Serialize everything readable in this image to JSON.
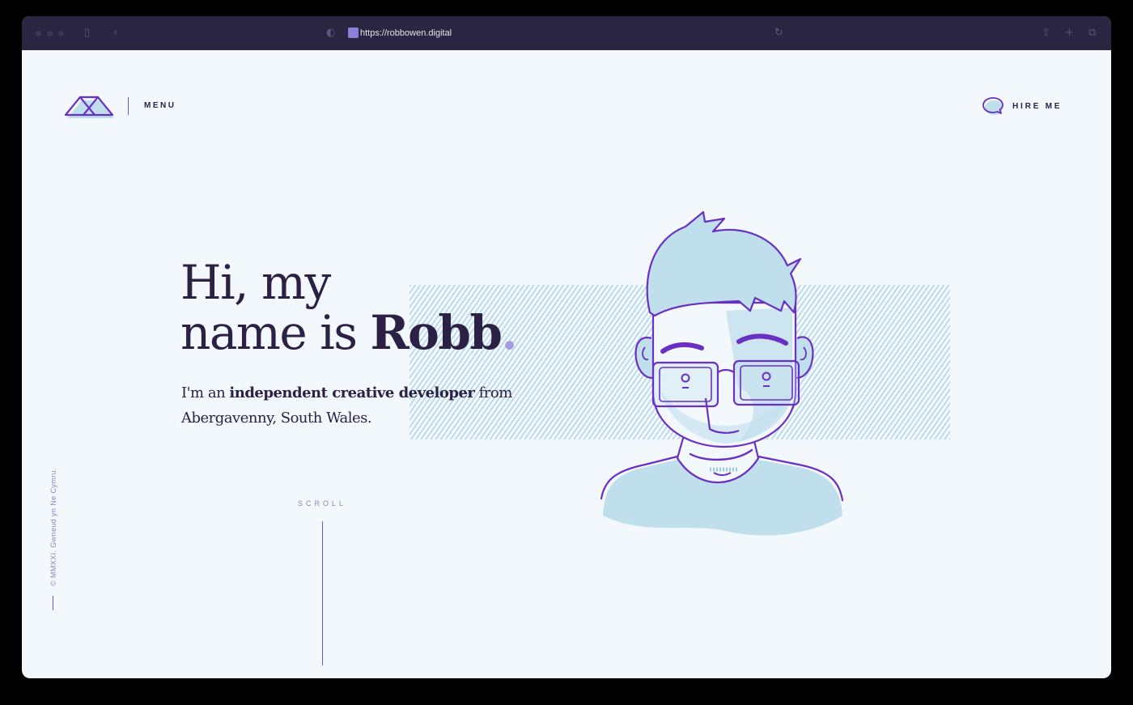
{
  "browser": {
    "url": "https://robbowen.digital"
  },
  "nav": {
    "menu_label": "MENU",
    "hire_label": "HIRE ME"
  },
  "hero": {
    "headline_line1": "Hi, my",
    "headline_line2_prefix": "name is ",
    "headline_name": "Robb",
    "headline_period": ".",
    "intro_before": "I'm an ",
    "intro_bold": "independent creative developer",
    "intro_after": " from Abergavenny, South Wales."
  },
  "scroll_label": "SCROLL",
  "copyright": "© MMXXI. Gwneud yn Ne Cymru.",
  "colors": {
    "brand_purple": "#6a2fc4",
    "text_dark": "#2b2145",
    "accent_light_blue": "#c0dfec",
    "page_background": "#f3f8fc"
  }
}
